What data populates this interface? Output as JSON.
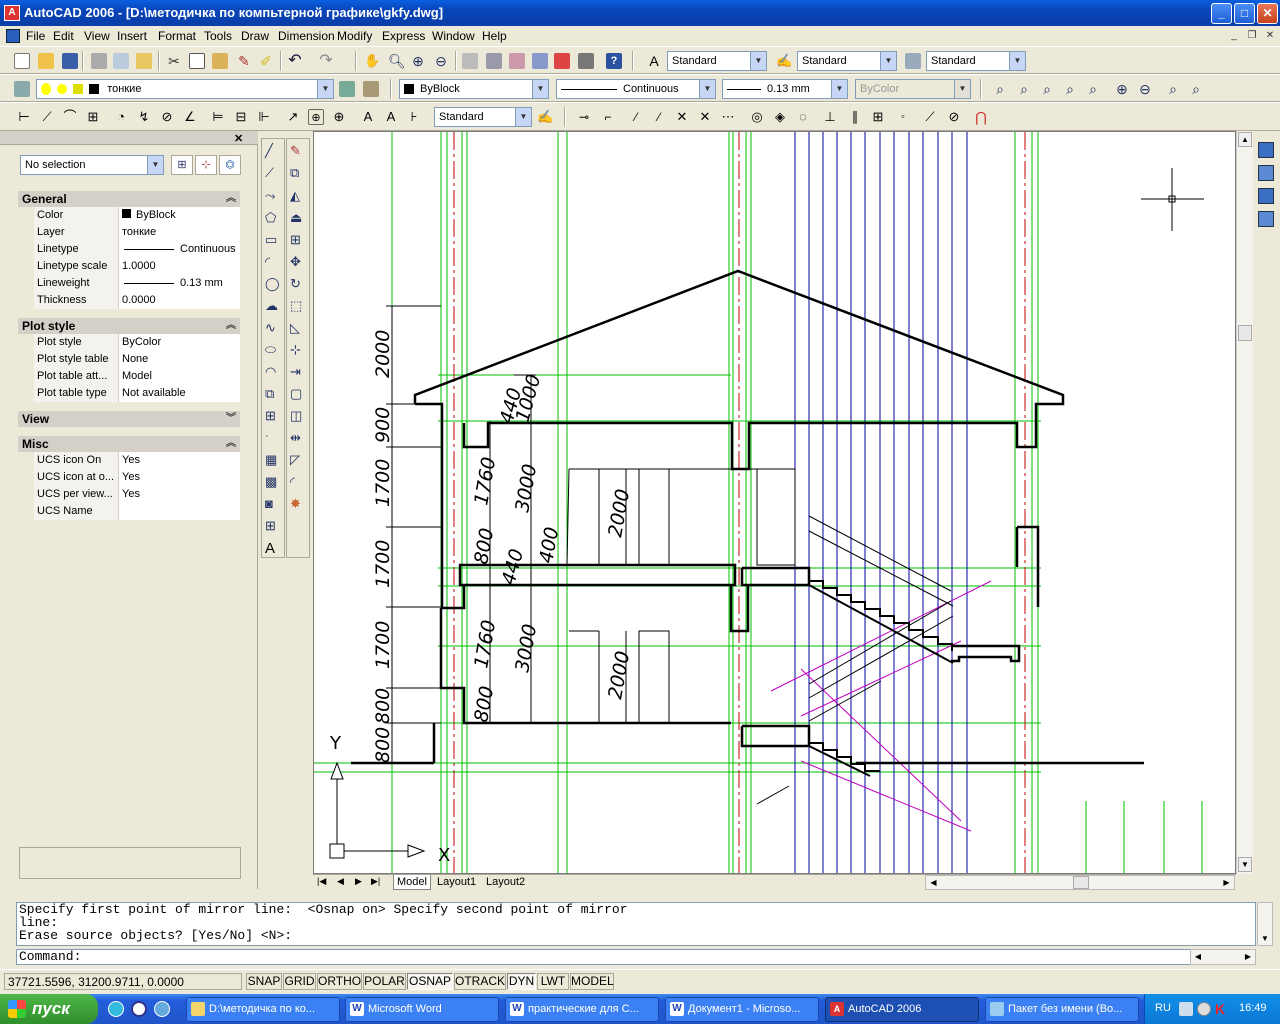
{
  "window": {
    "title": "AutoCAD 2006 - [D:\\методичка по компьтерной графике\\gkfy.dwg]"
  },
  "menu": [
    "File",
    "Edit",
    "View",
    "Insert",
    "Format",
    "Tools",
    "Draw",
    "Dimension",
    "Modify",
    "Express",
    "Window",
    "Help"
  ],
  "toolbars": {
    "text_style": "Standard",
    "dim_style": "Standard",
    "table_style": "Standard",
    "layer": "тонкие",
    "color": "ByBlock",
    "linetype": "Continuous",
    "lineweight": "0.13 mm",
    "plotstyle": "ByColor",
    "dim_style2": "Standard"
  },
  "properties": {
    "selection": "No selection",
    "sections": {
      "general": {
        "title": "General",
        "rows": [
          {
            "label": "Color",
            "value": "ByBlock"
          },
          {
            "label": "Layer",
            "value": "тонкие"
          },
          {
            "label": "Linetype",
            "value": "Continuous"
          },
          {
            "label": "Linetype scale",
            "value": "1.0000"
          },
          {
            "label": "Lineweight",
            "value": "0.13 mm"
          },
          {
            "label": "Thickness",
            "value": "0.0000"
          }
        ]
      },
      "plot": {
        "title": "Plot style",
        "rows": [
          {
            "label": "Plot style",
            "value": "ByColor"
          },
          {
            "label": "Plot style table",
            "value": "None"
          },
          {
            "label": "Plot table att...",
            "value": "Model"
          },
          {
            "label": "Plot table type",
            "value": "Not available"
          }
        ]
      },
      "view": {
        "title": "View"
      },
      "misc": {
        "title": "Misc",
        "rows": [
          {
            "label": "UCS icon On",
            "value": "Yes"
          },
          {
            "label": "UCS icon at o...",
            "value": "Yes"
          },
          {
            "label": "UCS per view...",
            "value": "Yes"
          },
          {
            "label": "UCS Name",
            "value": ""
          }
        ]
      }
    }
  },
  "drawing": {
    "dims_left": [
      "2000",
      "900",
      "1700",
      "1700",
      "1700",
      "800",
      "800"
    ],
    "dims_inner": [
      "440",
      "1000",
      "1760",
      "800",
      "440",
      "1760",
      "800"
    ],
    "dims_mid": [
      "3000",
      "400",
      "3000"
    ],
    "dims_door": [
      "2000",
      "2000"
    ],
    "ucs": {
      "x": "X",
      "y": "Y"
    },
    "colors": {
      "green": "#00c000",
      "blue": "#0000a0",
      "red": "#c00000",
      "magenta": "#c000c0",
      "black": "#000000"
    }
  },
  "tabs": [
    "Model",
    "Layout1",
    "Layout2"
  ],
  "command": {
    "history": "Specify first point of mirror line:  <Osnap on> Specify second point of mirror\nline:\nErase source objects? [Yes/No] <N>:",
    "prompt": "Command:"
  },
  "status": {
    "coords": "37721.5596, 31200.9711, 0.0000",
    "buttons": [
      "SNAP",
      "GRID",
      "ORTHO",
      "POLAR",
      "OSNAP",
      "OTRACK",
      "DYN",
      "LWT",
      "MODEL"
    ]
  },
  "taskbar": {
    "start": "пуск",
    "tasks": [
      "D:\\методичка по ко...",
      "Microsoft Word",
      "практические для С...",
      "Документ1 - Microso...",
      "AutoCAD 2006",
      "Пакет без имени (Во..."
    ],
    "lang": "RU",
    "time": "16:49"
  }
}
